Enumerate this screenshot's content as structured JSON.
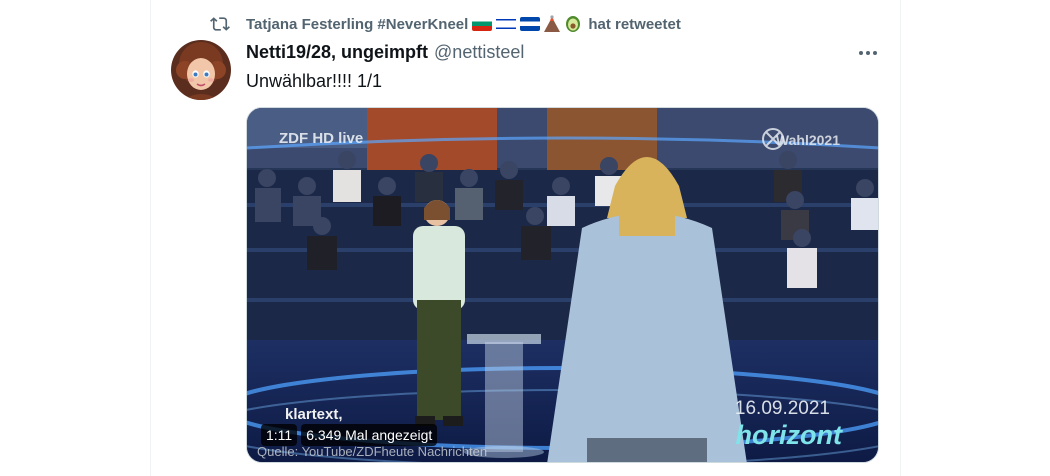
{
  "retweet": {
    "user": "Tatjana Festerling #NeverKneel",
    "suffix": "hat retweetet",
    "emoji": [
      "flag-bulgaria",
      "flag-israel",
      "flag-el-salvador",
      "volcano",
      "avocado"
    ]
  },
  "tweet": {
    "name": "Netti19/28, ungeimpft",
    "handle": "@nettisteel",
    "text": "Unwählbar!!!! 1/1"
  },
  "media": {
    "duration": "1:11",
    "views": "6.349 Mal angezeigt",
    "overlays": {
      "channel": "ZDF HD live",
      "show_tag": "Wahl2021",
      "date": "16.09.2021",
      "brand": "horizont",
      "program": "klartext,",
      "source": "Quelle: YouTube/ZDFheute Nachrichten"
    }
  },
  "colors": {
    "text_primary": "#0f1419",
    "text_secondary": "#536471",
    "border": "#cfd9de"
  }
}
